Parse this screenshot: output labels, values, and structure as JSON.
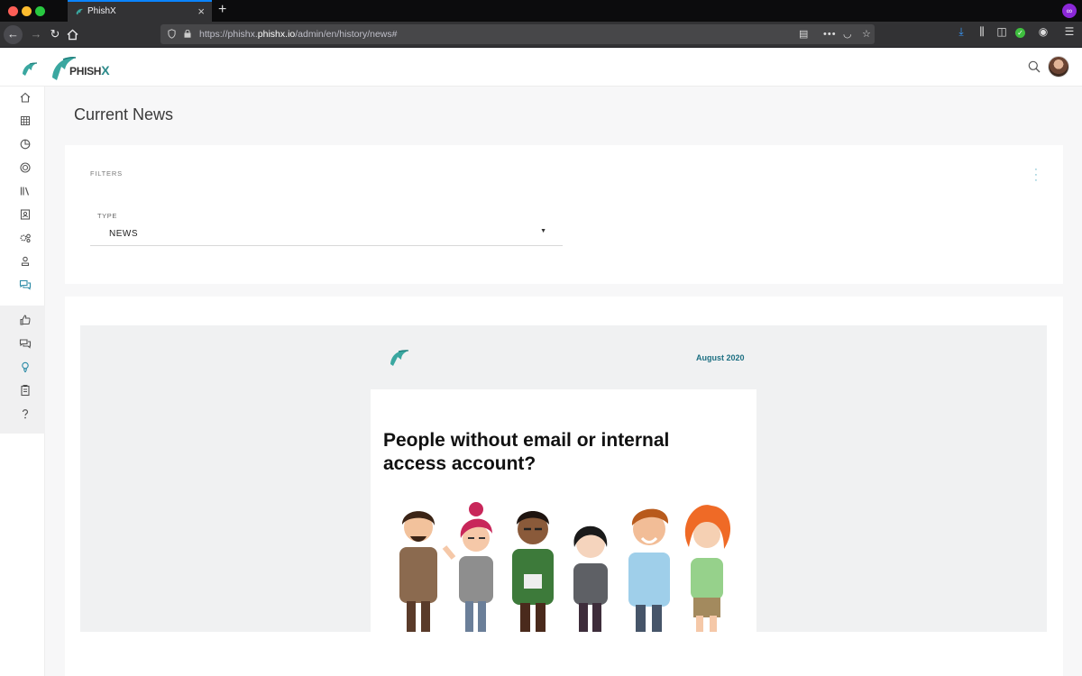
{
  "browser": {
    "tab_title": "PhishX",
    "new_tab_icon": "+",
    "close_tab_icon": "×",
    "url_prefix": "https://phishx.",
    "url_domain": "phishx.io",
    "url_path": "/admin/en/history/news#",
    "colors": {
      "active_tab_line": "#0a84ff",
      "dark": "#323234"
    }
  },
  "app": {
    "brand": "PHISH",
    "brand_x": "X",
    "brand_color": "#2b8a8a"
  },
  "sidebar": {
    "items": [
      {
        "name": "home-icon"
      },
      {
        "name": "dashboard-icon"
      },
      {
        "name": "reports-icon"
      },
      {
        "name": "target-icon"
      },
      {
        "name": "library-icon"
      },
      {
        "name": "contacts-icon"
      },
      {
        "name": "settings-icon"
      },
      {
        "name": "user-icon"
      },
      {
        "name": "chat-icon",
        "active": true
      },
      {
        "name": "thumbs-up-icon"
      },
      {
        "name": "comments-icon"
      },
      {
        "name": "lightbulb-icon",
        "active": true
      },
      {
        "name": "clipboard-icon"
      },
      {
        "name": "help-icon"
      }
    ],
    "active_color": "#2b8aa6"
  },
  "page": {
    "title": "Current News"
  },
  "filters": {
    "label": "FILTERS",
    "type_label": "TYPE",
    "type_value": "NEWS",
    "arrow": "▼"
  },
  "newsletter": {
    "date": "August 2020",
    "headline": "People without email or internal access account?"
  }
}
